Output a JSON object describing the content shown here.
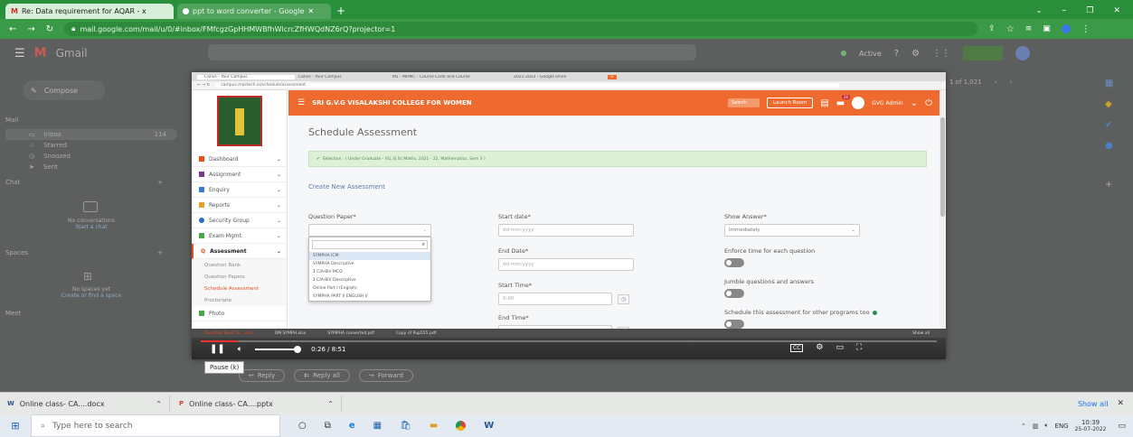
{
  "browser": {
    "tabs": [
      {
        "label": "Re: Data requirement for AQAR - x",
        "active": true
      },
      {
        "label": "ppt to word converter - Google",
        "active": false
      }
    ],
    "url": "mail.google.com/mail/u/0/#inbox/FMfcgzGpHHMWBfhWlcrcZfHWQdNZ6rQ?projector=1"
  },
  "gmail": {
    "brand": "Gmail",
    "compose": "Compose",
    "mail_heading": "Mail",
    "inbox": "Inbox",
    "inbox_count": "114",
    "starred": "Starred",
    "snoozed": "Snoozed",
    "sent": "Sent",
    "chat": "Chat",
    "chat_empty": "No conversations",
    "chat_start": "Start a chat",
    "spaces": "Spaces",
    "spaces_empty": "No spaces yet",
    "spaces_cta": "Create or find a space",
    "meet": "Meet",
    "status": "Active",
    "pagination": "1 of 1,021",
    "reply": "Reply",
    "reply_all": "Reply all",
    "forward": "Forward"
  },
  "video": {
    "inner_tabs": [
      "Canvs - Your Campus",
      "Canvs - Your Campus",
      "M1 - MHMC - Course Code and Course",
      "2021-2022 - Google Drive"
    ],
    "inner_url": "campus.mastech.in/schedule/assessment",
    "college": "SRI G.V.G VISALAKSHI COLLEGE FOR WOMEN",
    "search_placeholder": "Search",
    "launch": "Launch Room",
    "badge": "28",
    "user": "GVG Admin",
    "sidebar": [
      {
        "icon": "dashboard-icon",
        "label": "Dashboard",
        "color": "#e94e1b"
      },
      {
        "icon": "assignment-icon",
        "label": "Assignment",
        "color": "#7a3b8c"
      },
      {
        "icon": "enquiry-icon",
        "label": "Enquiry",
        "color": "#3a7bd5"
      },
      {
        "icon": "reports-icon",
        "label": "Reports",
        "color": "#e6a02a"
      },
      {
        "icon": "security-icon",
        "label": "Security Group",
        "color": "#2a6bc9"
      },
      {
        "icon": "exam-icon",
        "label": "Exam Mgmt.",
        "color": "#4aa64a"
      },
      {
        "icon": "assessment-icon",
        "label": "Assessment",
        "color": "#e94e1b"
      }
    ],
    "submenu": [
      "Question Bank",
      "Question Papers",
      "Schedule Assessment",
      "Proctoriate"
    ],
    "more_item": "Photo",
    "page_title": "Schedule Assessment",
    "selection": "Selection : ( Under Graduate - VG, B.Sc Maths, 2021 - 22, Mathematics, Sem 3 )",
    "create_title": "Create New Assessment",
    "question_paper_label": "Question Paper*",
    "start_date_label": "Start date*",
    "date_placeholder": "dd-mm-yyyy",
    "end_date_label": "End Date*",
    "start_time_label": "Start Time*",
    "end_time_label": "End Time*",
    "time_placeholder": "0:00",
    "show_answer_label": "Show Answer*",
    "show_answer_value": "Immediately",
    "enforce_label": "Enforce time for each question",
    "jumble_label": "Jumble questions and answers",
    "other_label": "Schedule this assessment for other programs too",
    "toggle_text": "NO",
    "dropdown_options": [
      "SYMPHA ICM",
      "SYMPHA Descriptive",
      "1 CIA-BIV MCQ",
      "1 CIA-BIV Descriptive",
      "Online Part I (English)",
      "SYMPHA PART II ENGLISH II"
    ],
    "downloads_inner": [
      "Question Bank Te....xlsx",
      "OM SYMPH.xlsx",
      "SYMPHA converted.pdf",
      "Copy of Pup555.pdf"
    ],
    "show_all_inner": "Show all",
    "time": "0:26 / 8:51",
    "tooltip": "Pause (k)",
    "progress": 0.05
  },
  "downloads": [
    {
      "name": "Online class- CA....docx"
    },
    {
      "name": "Online class- CA....pptx"
    }
  ],
  "show_all": "Show all",
  "taskbar": {
    "search": "Type here to search",
    "lang": "ENG",
    "time": "10:39",
    "date": "25-07-2022"
  },
  "colors": {
    "chrome_green": "#2a8f3a",
    "gvg_orange": "#ee6a2e",
    "selected": "#e94e1b"
  }
}
